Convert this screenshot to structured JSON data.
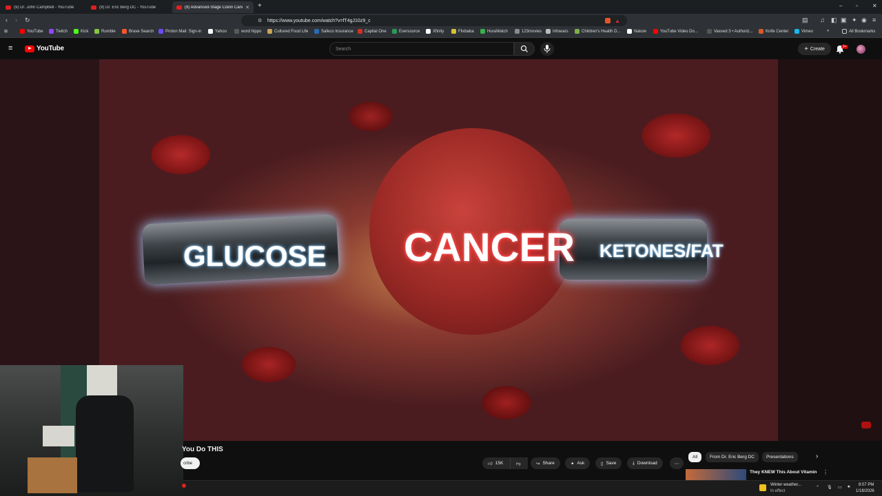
{
  "browser": {
    "tabs": [
      {
        "title": "(9) Dr. John Campbell - YouTube",
        "active": false
      },
      {
        "title": "(9) Dr. Eric Berg DC - YouTube",
        "active": false
      },
      {
        "title": "(9) Advanced-Stage Colon Canc",
        "active": true
      }
    ],
    "url": "https://www.youtube.com/watch?v=fT4gJ10z9_c",
    "bookmarks": [
      "YouTube",
      "Twitch",
      "Kick",
      "Rumble",
      "Brave Search",
      "Proton Mail: Sign-in",
      "Yahoo",
      "word hippo",
      "Cultured Food Life",
      "Safeco Insurance",
      "Capital One",
      "Eversource",
      "Xfinity",
      "Flixbaba",
      "HuraWatch",
      "123movies",
      "Infowars",
      "Children's Health D...",
      "Nature",
      "YouTube Video Do...",
      "Vaxxed 3 • Authoriz...",
      "Knife Center",
      "Vimeo"
    ],
    "all_bookmarks": "All Bookmarks"
  },
  "youtube": {
    "logo_text": "YouTube",
    "search_placeholder": "Search",
    "create_label": "Create",
    "notif_badge": "9+"
  },
  "video": {
    "thumb_words": {
      "left": "GLUCOSE",
      "center": "CANCER",
      "right": "KETONES/FAT"
    },
    "title_fragment": "You Do THIS",
    "subscribe_fragment": "cribe",
    "actions": {
      "likes": "15K",
      "share": "Share",
      "ask": "Ask",
      "save": "Save",
      "download": "Download"
    }
  },
  "recommendations": {
    "chips": [
      "All",
      "From Dr. Eric Berg DC",
      "Presentations"
    ],
    "first_title": "They KNEW This About Vitamin"
  },
  "taskbar": {
    "weather_title": "Winter weather...",
    "weather_sub": "In effect",
    "time": "8:07 PM",
    "date": "1/18/2026"
  },
  "colors": {
    "youtube_red": "#ff0000",
    "background": "#0f0f0f",
    "pill": "#272727"
  }
}
